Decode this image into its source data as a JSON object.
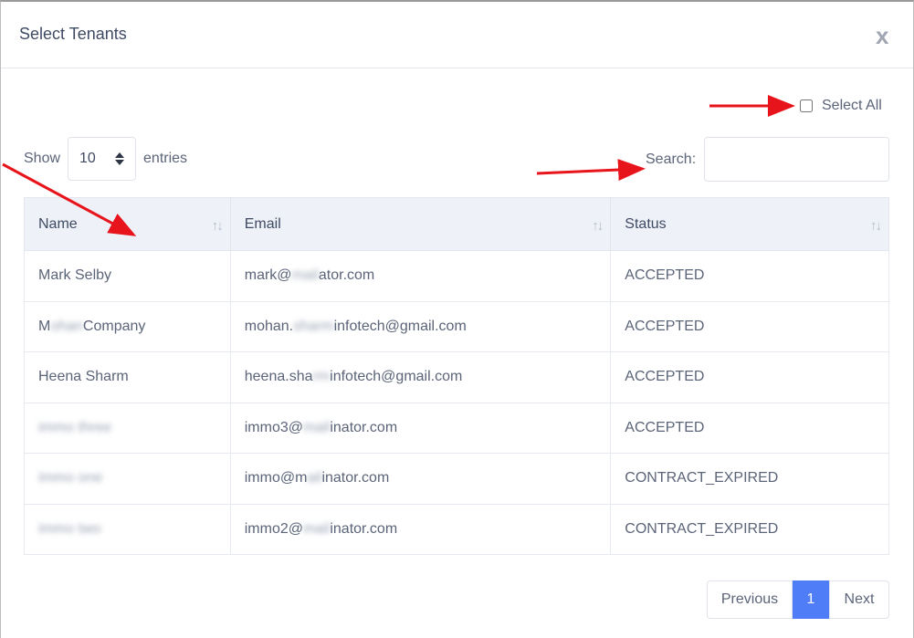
{
  "modal": {
    "title": "Select Tenants",
    "close_label": "x"
  },
  "controls": {
    "select_all_label": "Select All",
    "show_label": "Show",
    "entries_value": "10",
    "entries_label": "entries",
    "search_label": "Search:",
    "search_value": ""
  },
  "table": {
    "headers": [
      "Name",
      "Email",
      "Status"
    ],
    "sort_icon": "↑↓",
    "rows": [
      {
        "name": "Mark Selby",
        "email_a": "mark@",
        "email_b": "mail",
        "email_c": "ator.com",
        "status": "ACCEPTED"
      },
      {
        "name_a": "M",
        "name_b": "ohan",
        "name_c": "Company",
        "email_a": "mohan.",
        "email_b": "sharm",
        "email_c": "infotech@gmail.com",
        "status": "ACCEPTED"
      },
      {
        "name": "Heena Sharm",
        "email_a": "heena.sha",
        "email_b": "rm",
        "email_c": "infotech@gmail.com",
        "status": "ACCEPTED"
      },
      {
        "name": "immo three",
        "email_a": "immo3@",
        "email_b": "mail",
        "email_c": "inator.com",
        "status": "ACCEPTED"
      },
      {
        "name": "immo one",
        "email_a": "immo@m",
        "email_b": "ail",
        "email_c": "inator.com",
        "status": "CONTRACT_EXPIRED"
      },
      {
        "name": "immo two",
        "email_a": "immo2@",
        "email_b": "mail",
        "email_c": "inator.com",
        "status": "CONTRACT_EXPIRED"
      }
    ]
  },
  "pagination": {
    "previous": "Previous",
    "current": "1",
    "next": "Next"
  },
  "colors": {
    "primary": "#4f7cf7",
    "annotation_arrow": "#e8141b",
    "header_bg": "#eef2f8"
  }
}
